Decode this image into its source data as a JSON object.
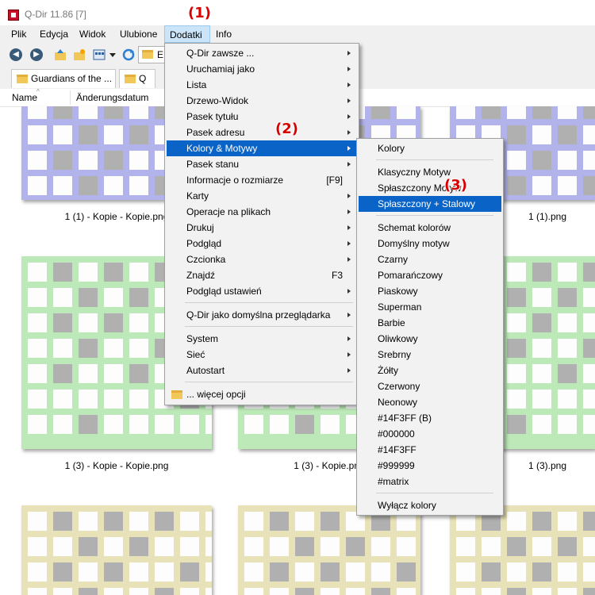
{
  "window": {
    "title": "Q-Dir 11.86 [7]"
  },
  "menubar": [
    "Plik",
    "Edycja",
    "Widok",
    "Ulubione",
    "Dodatki",
    "Info"
  ],
  "toolbar": {
    "address_text": "E:"
  },
  "tabs": [
    "Guardians of the ...",
    "Q"
  ],
  "columns": [
    "Name",
    "Änderungsdatum"
  ],
  "files": {
    "row1": [
      "1 (1) - Kopie - Kopie.png",
      "1 (1).png"
    ],
    "row2": [
      "1 (3) - Kopie - Kopie.png",
      "1 (3) - Kopie.png",
      "1 (3).png"
    ]
  },
  "dodatki_menu": [
    {
      "label": "Q-Dir zawsze ...",
      "arrow": true
    },
    {
      "label": "Uruchamiaj jako",
      "arrow": true
    },
    {
      "label": "Lista",
      "arrow": true
    },
    {
      "label": "Drzewo-Widok",
      "arrow": true
    },
    {
      "label": "Pasek tytułu",
      "arrow": true
    },
    {
      "label": "Pasek adresu",
      "arrow": true
    },
    {
      "label": "Kolory & Motywy",
      "arrow": true,
      "highlight": true
    },
    {
      "label": "Pasek stanu",
      "arrow": true
    },
    {
      "label": "Informacje o rozmiarze",
      "shortcut": "[F9]"
    },
    {
      "label": "Karty",
      "arrow": true
    },
    {
      "label": "Operacje na plikach",
      "arrow": true
    },
    {
      "label": "Drukuj",
      "arrow": true
    },
    {
      "label": "Podgląd",
      "arrow": true
    },
    {
      "label": "Czcionka",
      "arrow": true
    },
    {
      "label": "Znajdź",
      "shortcut": "F3"
    },
    {
      "label": "Podgląd ustawień",
      "arrow": true
    },
    {
      "separator": true
    },
    {
      "label": "Q-Dir jako domyślna przeglądarka",
      "arrow": true
    },
    {
      "separator": true
    },
    {
      "label": "System",
      "arrow": true
    },
    {
      "label": "Sieć",
      "arrow": true
    },
    {
      "label": "Autostart",
      "arrow": true
    },
    {
      "separator": true
    },
    {
      "label": "... więcej opcji",
      "folder": true
    }
  ],
  "colors_submenu": [
    {
      "label": "Kolory"
    },
    {
      "separator": true
    },
    {
      "label": "Klasyczny Motyw"
    },
    {
      "label": "Spłaszczony Motyw"
    },
    {
      "label": "Spłaszczony + Stalowy",
      "highlight": true
    },
    {
      "separator": true
    },
    {
      "label": "Schemat kolorów"
    },
    {
      "label": "Domyślny motyw"
    },
    {
      "label": "Czarny"
    },
    {
      "label": "Pomarańczowy"
    },
    {
      "label": "Piaskowy"
    },
    {
      "label": "Superman"
    },
    {
      "label": "Barbie"
    },
    {
      "label": "Oliwkowy"
    },
    {
      "label": "Srebrny"
    },
    {
      "label": "Żółty"
    },
    {
      "label": "Czerwony"
    },
    {
      "label": "Neonowy"
    },
    {
      "label": "#14F3FF (B)"
    },
    {
      "label": "#000000"
    },
    {
      "label": "#14F3FF"
    },
    {
      "label": "#999999"
    },
    {
      "label": "#matrix"
    },
    {
      "separator": true
    },
    {
      "label": "Wyłącz kolory"
    }
  ],
  "callouts": [
    "(1)",
    "(2)",
    "(3)"
  ],
  "colors": {
    "accent": "#0a64c8",
    "callout": "#d90000",
    "thumb_blue": "#b3b3ec",
    "thumb_green": "#bde8b8",
    "thumb_yellow": "#e8e2b8",
    "thumb_gray": "#b0b0b0"
  }
}
